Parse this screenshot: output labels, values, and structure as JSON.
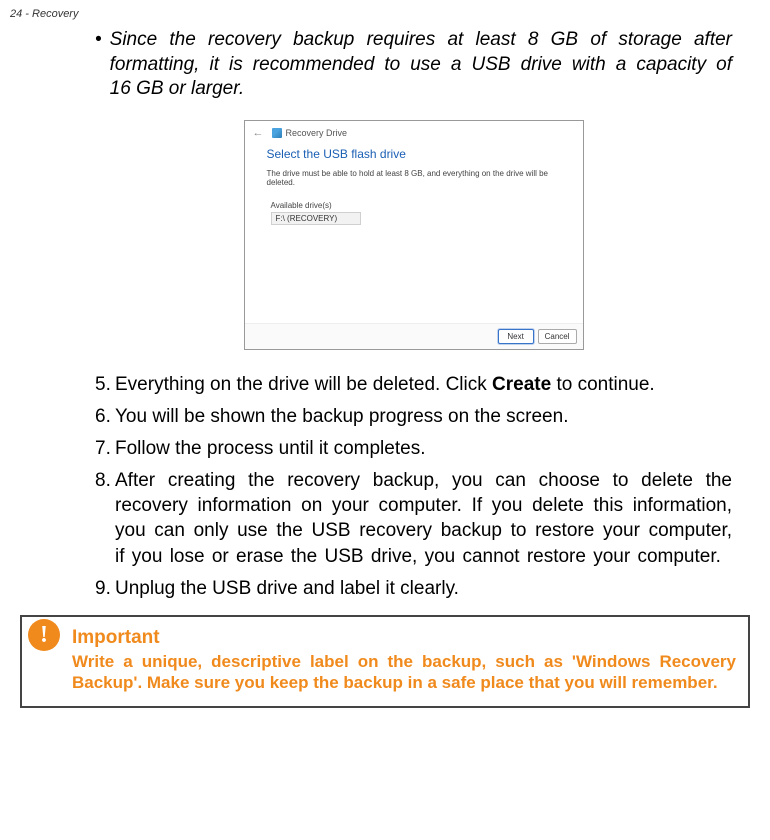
{
  "header": "24 - Recovery",
  "bullet": {
    "marker": "•",
    "text": "Since the recovery backup requires at least 8 GB of storage after formatting, it is recommended to use a USB drive with a capacity of 16 GB or larger."
  },
  "dialog": {
    "back_icon": "←",
    "title": "Recovery Drive",
    "heading": "Select the USB flash drive",
    "subtext": "The drive must be able to hold at least 8 GB, and everything on the drive will be deleted.",
    "available_label": "Available drive(s)",
    "drive": "F:\\ (RECOVERY)",
    "next_label": "Next",
    "cancel_label": "Cancel"
  },
  "steps": {
    "s5_num": "5.",
    "s5_pre": "Everything on the drive will be deleted. Click ",
    "s5_bold": "Create",
    "s5_post": " to continue.",
    "s6_num": "6.",
    "s6": "You will be shown the backup progress on the screen.",
    "s7_num": "7.",
    "s7": "Follow the process until it completes.",
    "s8_num": "8.",
    "s8": "After creating the recovery backup, you can choose to delete the recovery information on your computer. If you delete this information, you can only use the USB recovery backup to restore your computer, if you lose or erase the USB drive, you cannot restore your computer.",
    "s9_num": "9.",
    "s9": "Unplug the USB drive and label it clearly."
  },
  "note": {
    "icon_glyph": "!",
    "title": "Important",
    "text": "Write a unique, descriptive label on the backup, such as 'Windows Recovery Backup'. Make sure you keep the backup in a safe place that you will remember."
  }
}
